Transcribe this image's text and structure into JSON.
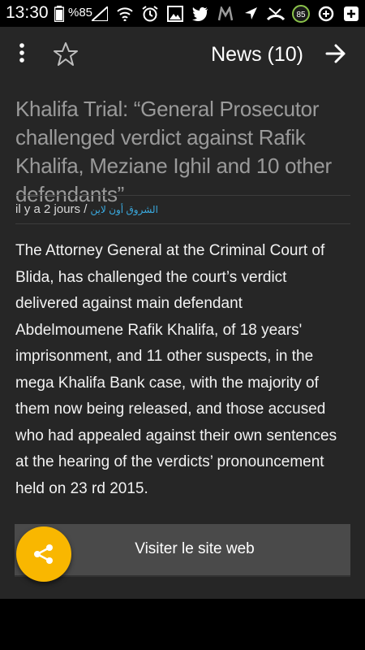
{
  "status_bar": {
    "time": "13:30",
    "battery_percent": "%85",
    "badge_count": "85",
    "icons": [
      "signal-icon",
      "wifi-icon",
      "alarm-icon",
      "image-icon",
      "twitter-icon",
      "m-app-icon",
      "location-icon",
      "missed-call-icon",
      "badge-icon",
      "app-icon",
      "add-icon"
    ]
  },
  "toolbar": {
    "title": "News (10)",
    "menu_icon": "more-vert-icon",
    "favorite_icon": "star-outline-icon",
    "next_icon": "arrow-forward-icon"
  },
  "article": {
    "headline": "Khalifa Trial: “General Prosecutor challenged verdict against Rafik Khalifa, Meziane Ighil and 10 other defendants”",
    "age": "il y a 2 jours /",
    "source": "الشروق أون لاين",
    "body": "The Attorney General at the Criminal Court of Blida, has challenged the court’s verdict delivered against main defendant Abdelmoumene Rafik Khalifa, of 18 years' imprisonment, and 11 other suspects, in the mega Khalifa Bank case, with the majority of them now being released, and those accused who had appealed against their own sentences at the hearing of the verdicts’ pronouncement held on 23 rd 2015."
  },
  "actions": {
    "visit_label": "Visiter le site web",
    "share_icon": "share-icon"
  },
  "colors": {
    "background": "#262626",
    "headline": "#9a9a9a",
    "source_link": "#3aa9de",
    "fab": "#f9b700",
    "button": "#4a4a4a"
  }
}
